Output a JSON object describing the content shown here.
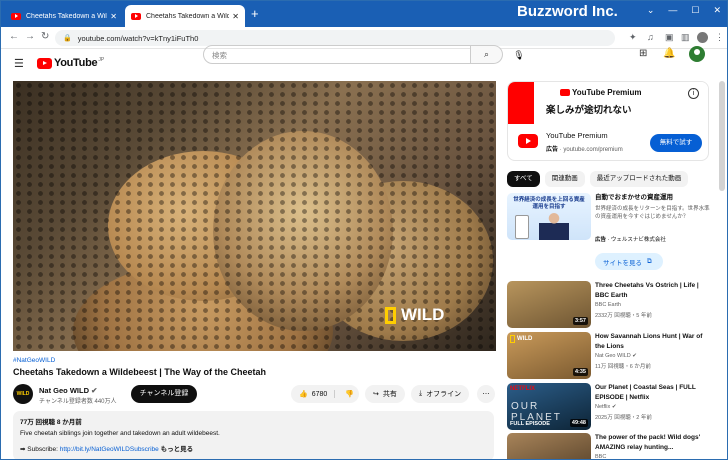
{
  "browser": {
    "tabs": [
      {
        "title": "Cheetahs Takedown a Wildebeest"
      },
      {
        "title": "Cheetahs Takedown a Wildebeest"
      }
    ],
    "new_tab": "+",
    "overlay_brand": "Buzzword Inc.",
    "url": "youtube.com/watch?v=kTny1iFuTh0"
  },
  "youtube": {
    "logo": "YouTube",
    "logo_suffix": "JP",
    "search_placeholder": "検索"
  },
  "video": {
    "hashtag": "#NatGeoWILD",
    "title": "Cheetahs Takedown a Wildebeest | The Way of the Cheetah",
    "watermark": "WILD",
    "channel": {
      "name": "Nat Geo WILD",
      "subscribers": "チャンネル登録者数 440万人",
      "avatar_text": "WILD"
    },
    "subscribe_label": "チャンネル登録",
    "likes": "6780",
    "share_label": "共有",
    "offline_label": "オフライン",
    "description": {
      "stats": "77万 回視聴  8 か月前",
      "line1": "Five cheetah siblings join together and takedown an adult wildebeest.",
      "subscribe_prefix": "➡ Subscribe: ",
      "link": "http://bit.ly/NatGeoWILDSubscribe",
      "more": "もっと見る"
    }
  },
  "sidebar_ad": {
    "brand": "YouTube Premium",
    "headline": "楽しみが途切れない",
    "name": "YouTube Premium",
    "sponsor_label": "広告",
    "sponsor_domain": "youtube.com/premium",
    "cta": "無料で試す",
    "info": "i"
  },
  "chips": [
    "すべて",
    "関連動画",
    "最近アップロードされた動画"
  ],
  "recommendations": [
    {
      "title": "自動でおまかせの資産運用",
      "desc": "世界経済の成長をリターンを目指す。世界水準の資産運用を今すぐはじめませんか？",
      "sponsor_label": "広告",
      "sponsor": "ウェルスナビ株式会社",
      "thumb_text": "世界経済の成長を上回る資産運用を目指す",
      "cta": "サイトを見る"
    },
    {
      "title": "Three Cheetahs Vs Ostrich | Life | BBC Earth",
      "channel": "BBC Earth",
      "meta": "2332万 回視聴・5 年前",
      "duration": "3:57"
    },
    {
      "title": "How Savannah Lions Hunt | War of the Lions",
      "channel": "Nat Geo WILD",
      "meta": "11万 回視聴・6 か月前",
      "duration": "4:35",
      "thumb_label": "WILD"
    },
    {
      "title": "Our Planet | Coastal Seas | FULL EPISODE | Netflix",
      "channel": "Netflix",
      "meta": "2025万 回視聴・2 年前",
      "duration": "49:48",
      "thumb_label": "NETFLIX",
      "thumb_big": "OUR PLANET",
      "thumb_badge": "FULL EPISODE"
    },
    {
      "title": "The power of the pack! Wild dogs' AMAZING relay hunting...",
      "channel": "BBC"
    }
  ]
}
